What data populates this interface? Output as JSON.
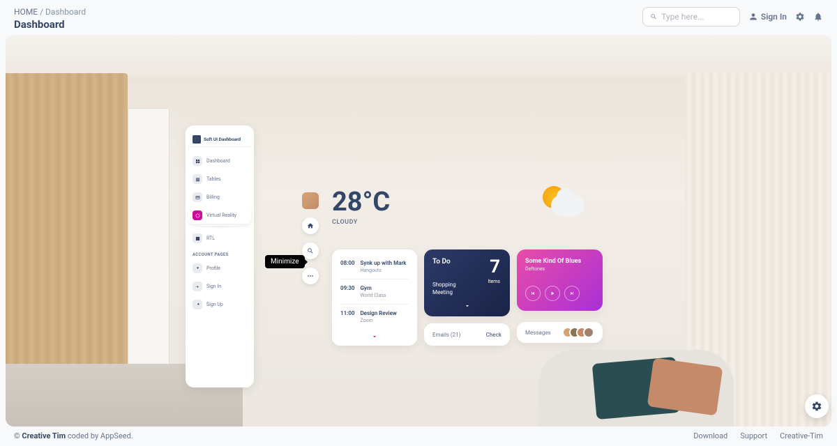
{
  "breadcrumb": {
    "home": "HOME",
    "current": "Dashboard"
  },
  "page_title": "Dashboard",
  "search": {
    "placeholder": "Type here..."
  },
  "header": {
    "signin": "Sign In"
  },
  "sidebar": {
    "brand": "Soft UI Dashboard",
    "items": [
      {
        "label": "Dashboard"
      },
      {
        "label": "Tables"
      },
      {
        "label": "Billing"
      },
      {
        "label": "Virtual Reality"
      },
      {
        "label": "RTL"
      }
    ],
    "section": "ACCOUNT PAGES",
    "account_items": [
      {
        "label": "Profile"
      },
      {
        "label": "Sign In"
      },
      {
        "label": "Sign Up"
      }
    ]
  },
  "tooltip": "Minimize",
  "weather": {
    "temp": "28°C",
    "condition": "CLOUDY"
  },
  "schedule": [
    {
      "time": "08:00",
      "title": "Synk up with Mark",
      "sub": "Hangouts"
    },
    {
      "time": "09:30",
      "title": "Gym",
      "sub": "World Class"
    },
    {
      "time": "11:00",
      "title": "Design Review",
      "sub": "Zoom"
    }
  ],
  "todo": {
    "title": "To Do",
    "count": "7",
    "unit": "Items",
    "sub1": "Shopping",
    "sub2": "Meeting"
  },
  "emails": {
    "label": "Emails (21)",
    "action": "Check"
  },
  "music": {
    "title": "Some Kind Of Blues",
    "artist": "Deftones"
  },
  "messages": {
    "label": "Messages"
  },
  "footer": {
    "copyright_prefix": "© ",
    "brand": "Creative Tim",
    "copyright_suffix": " coded by AppSeed.",
    "links": [
      "Download",
      "Support",
      "Creative-Tim"
    ]
  }
}
